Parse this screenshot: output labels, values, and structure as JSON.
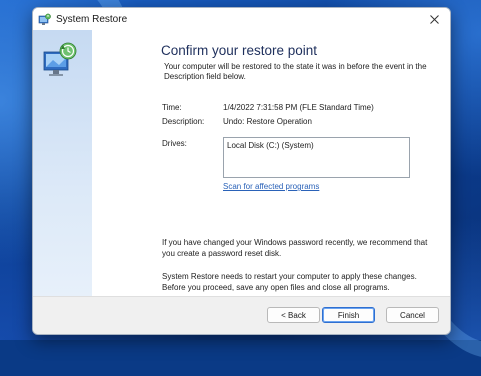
{
  "window": {
    "title": "System Restore",
    "icon": "system-restore-icon",
    "close_icon": "close-icon"
  },
  "page": {
    "heading": "Confirm your restore point",
    "intro": "Your computer will be restored to the state it was in before the event in the Description field below."
  },
  "details": {
    "time_label": "Time:",
    "time_value": "1/4/2022 7:31:58 PM (FLE Standard Time)",
    "description_label": "Description:",
    "description_value": "Undo: Restore Operation",
    "drives_label": "Drives:",
    "drives": [
      "Local Disk (C:) (System)"
    ],
    "scan_link": "Scan for affected programs"
  },
  "notes": {
    "password": "If you have changed your Windows password recently, we recommend that you create a password reset disk.",
    "restart": "System Restore needs to restart your computer to apply these changes. Before you proceed, save any open files and close all programs."
  },
  "buttons": {
    "back": "< Back",
    "finish": "Finish",
    "cancel": "Cancel"
  },
  "colors": {
    "heading": "#1e2f5c",
    "link": "#2a62b8",
    "primary_border": "#2f6fd0"
  }
}
